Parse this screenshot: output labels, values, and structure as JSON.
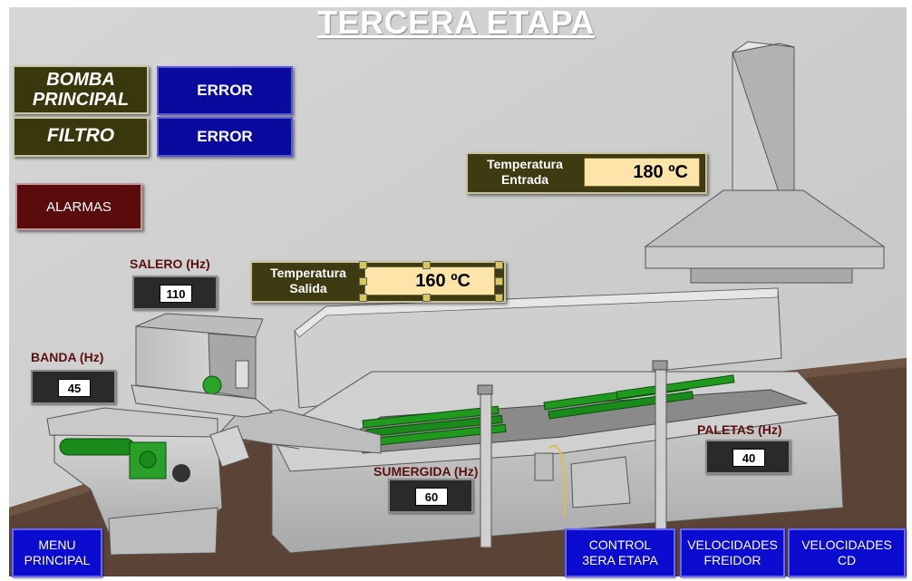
{
  "title": "TERCERA ETAPA",
  "status": {
    "bomba_label": "BOMBA\nPRINCIPAL",
    "bomba_value": "ERROR",
    "filtro_label": "FILTRO",
    "filtro_value": "ERROR"
  },
  "alarm_button": "ALARMAS",
  "temp_entrada": {
    "label": "Temperatura\nEntrada",
    "value": "180  ºC"
  },
  "temp_salida": {
    "label": "Temperatura\nSalida",
    "value": "160 ºC"
  },
  "speeds": {
    "salero": {
      "label": "SALERO (Hz)",
      "value": "110"
    },
    "banda": {
      "label": "BANDA (Hz)",
      "value": "45"
    },
    "sumergida": {
      "label": "SUMERGIDA (Hz)",
      "value": "60"
    },
    "paletas": {
      "label": "PALETAS (Hz)",
      "value": "40"
    }
  },
  "nav": {
    "menu": "MENU\nPRINCIPAL",
    "control": "CONTROL\n3ERA ETAPA",
    "vel_freidor": "VELOCIDADES\nFREIDOR",
    "vel_cd": "VELOCIDADES\nCD"
  },
  "colors": {
    "wall": "#cfcfcf",
    "floor": "#5a4334",
    "machine": "#c2c2c2",
    "olive_panel": "#39380d",
    "error_blue": "#0a0a9e",
    "alarm_red": "#5a0b0b",
    "temp_field": "#fde4a9",
    "nav_blue": "#0c0cd0",
    "roller_green": "#1a8a1a"
  }
}
